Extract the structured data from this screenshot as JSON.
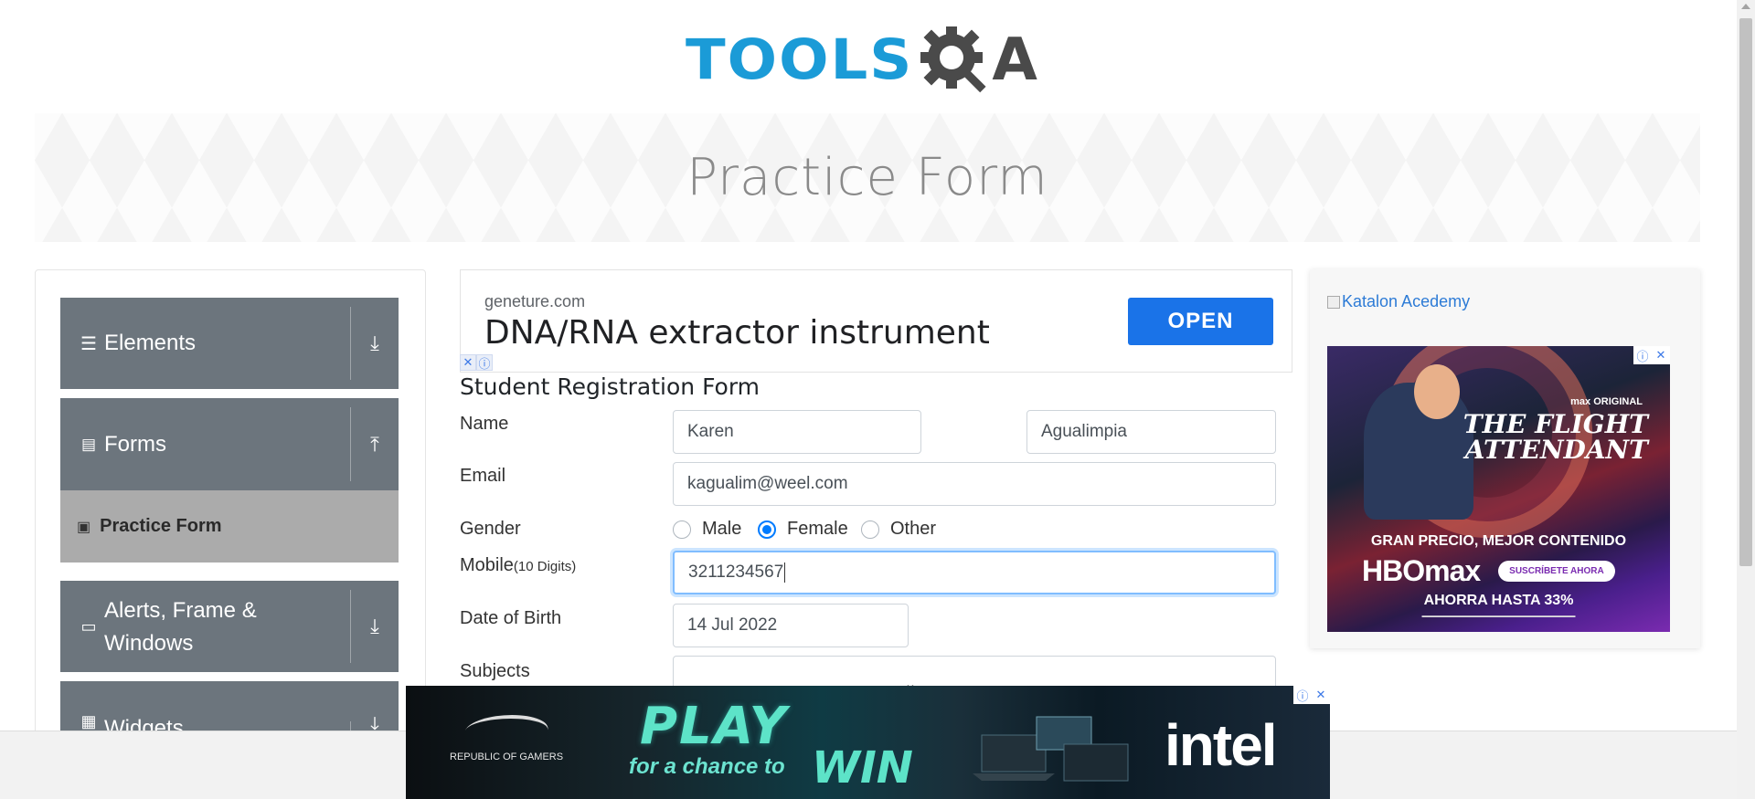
{
  "header": {
    "logo_text": "TOOLS",
    "logo_suffix": "A"
  },
  "banner": {
    "title": "Practice Form"
  },
  "sidebar": {
    "groups": [
      {
        "label": "Elements",
        "icon": "hamburger-icon",
        "toggle_icon": "download-arrow-icon"
      },
      {
        "label": "Forms",
        "icon": "document-icon",
        "toggle_icon": "upload-arrow-icon"
      },
      {
        "label": "Alerts, Frame & Windows",
        "icon": "window-icon",
        "toggle_icon": "download-arrow-icon"
      },
      {
        "label": "Widgets",
        "icon": "widgets-icon",
        "toggle_icon": "download-arrow-icon"
      }
    ],
    "active_item": {
      "label": "Practice Form",
      "icon": "form-icon"
    }
  },
  "ad_top": {
    "domain": "geneture.com",
    "headline": "DNA/RNA extractor instrument",
    "button_label": "OPEN",
    "button_color": "#1a73e8"
  },
  "form": {
    "title": "Student Registration Form",
    "name_label": "Name",
    "first_name": "Karen",
    "last_name": "Agualimpia",
    "email_label": "Email",
    "email": "kagualim@weel.com",
    "gender_label": "Gender",
    "genders": [
      "Male",
      "Female",
      "Other"
    ],
    "selected_gender": "Female",
    "mobile_label": "Mobile",
    "mobile_hint": "(10 Digits)",
    "mobile": "3211234567",
    "dob_label": "Date of Birth",
    "dob": "14 Jul 2022",
    "subjects_label": "Subjects"
  },
  "ad_right": {
    "image_alt": "Katalon Acedemy",
    "hbo": {
      "max_original": "max ORIGINAL",
      "show_title": "THE FLIGHT ATTENDANT",
      "promo": "GRAN PRECIO, MEJOR CONTENIDO",
      "brand": "HBOmax",
      "cta": "SUSCRÍBETE AHORA",
      "savings": "AHORRA HASTA 33%"
    }
  },
  "ad_bottom": {
    "brand_left": "REPUBLIC OF GAMERS",
    "headline": "PLAY",
    "sub": "for a chance to",
    "win": "WIN",
    "brand_right": "intel"
  },
  "colors": {
    "primary": "#1b9bd7",
    "sidebar_group": "#6c757d",
    "sidebar_active": "#ababab",
    "focus": "#80bdff"
  }
}
